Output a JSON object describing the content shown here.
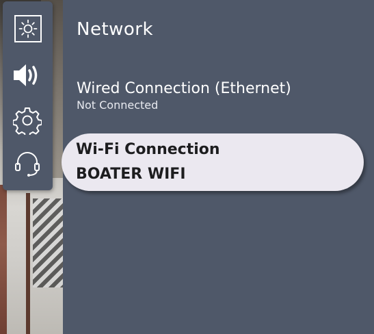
{
  "sidebar": {
    "items": [
      {
        "icon": "display-brightness-icon",
        "selected": true
      },
      {
        "icon": "speaker-volume-icon",
        "selected": false
      },
      {
        "icon": "gear-icon",
        "selected": false
      },
      {
        "icon": "headset-support-icon",
        "selected": false
      }
    ]
  },
  "panel": {
    "title": "Network",
    "wired": {
      "label": "Wired Connection (Ethernet)",
      "status": "Not Connected"
    },
    "wifi": {
      "label": "Wi-Fi Connection",
      "network": "BOATER WIFI",
      "focused": true
    }
  },
  "colors": {
    "panel_bg": "#4f5869",
    "focus_bg": "#ebe8f0",
    "text_light": "#ffffff",
    "text_dark": "#1d1d1f"
  }
}
